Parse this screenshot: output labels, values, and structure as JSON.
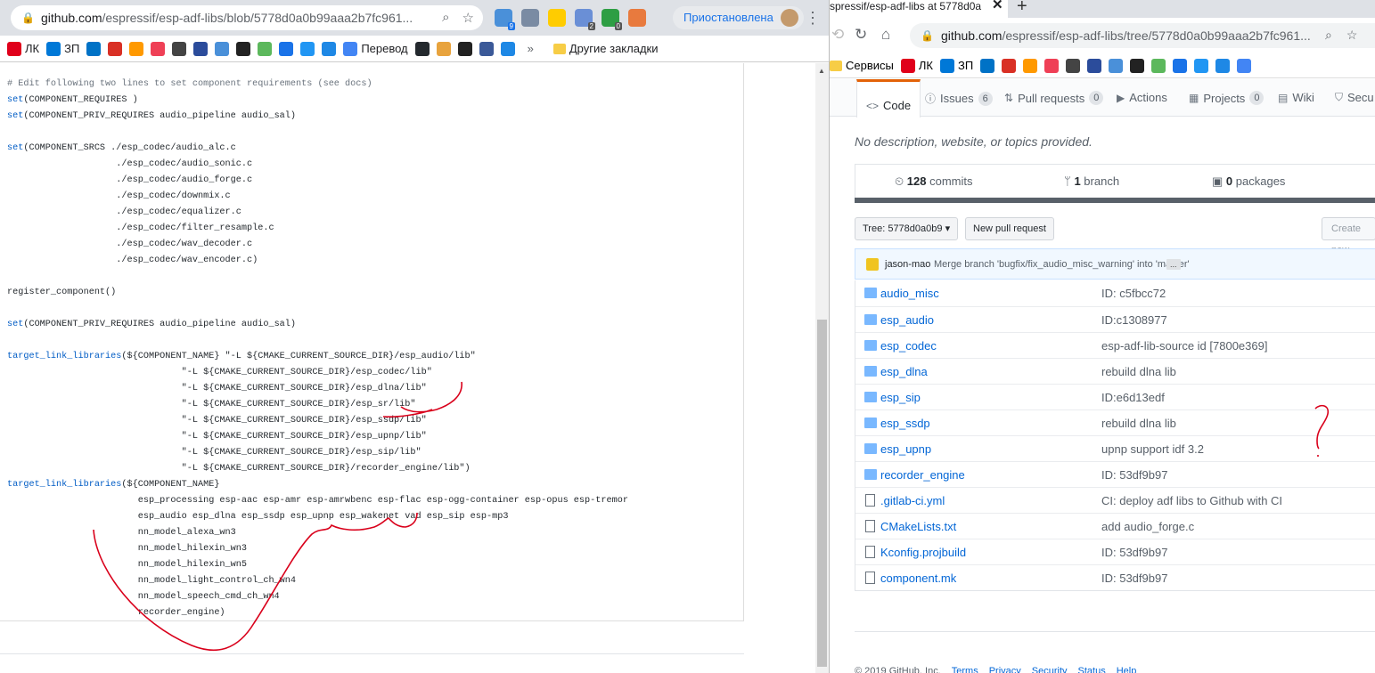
{
  "left_browser": {
    "url_host": "github.com",
    "url_path": "/espressif/esp-adf-libs/blob/5778d0a0b99aaa2b7fc961...",
    "profile_label": "Приостановлена",
    "extension_badges": {
      "badge_9": "9",
      "badge_2": "2",
      "badge_0": "0"
    },
    "bookmarks": [
      {
        "label": "ЛК",
        "icon": "opera-icon",
        "color": "#e0001b"
      },
      {
        "label": "ЗП",
        "icon": "skype-icon",
        "color": "#0078d7"
      },
      {
        "label": "",
        "icon": "outlook-icon",
        "color": "#0072c6"
      },
      {
        "label": "",
        "icon": "gmail-icon",
        "color": "#d93025"
      },
      {
        "label": "",
        "icon": "mail-icon",
        "color": "#ff9900"
      },
      {
        "label": "",
        "icon": "pocket-icon",
        "color": "#ef4056"
      },
      {
        "label": "",
        "icon": "bag-icon",
        "color": "#444444"
      },
      {
        "label": "",
        "icon": "emblem-icon",
        "color": "#2b4c9b"
      },
      {
        "label": "",
        "icon": "map-icon",
        "color": "#4a90d9"
      },
      {
        "label": "",
        "icon": "circle-icon",
        "color": "#222222"
      },
      {
        "label": "",
        "icon": "two-icon",
        "color": "#5cb85c"
      },
      {
        "label": "",
        "icon": "g-icon",
        "color": "#1a73e8"
      },
      {
        "label": "",
        "icon": "ring-icon",
        "color": "#2196f3"
      },
      {
        "label": "",
        "icon": "vs-icon",
        "color": "#1e88e5"
      },
      {
        "label": "Перевод",
        "icon": "translate-icon",
        "color": "#4285f4"
      },
      {
        "label": "",
        "icon": "github-icon",
        "color": "#24292e"
      },
      {
        "label": "",
        "icon": "fox-icon",
        "color": "#e8a33d"
      },
      {
        "label": "",
        "icon": "a-icon",
        "color": "#222222"
      },
      {
        "label": "",
        "icon": "facebook-icon",
        "color": "#3b5998"
      },
      {
        "label": "",
        "icon": "network-icon",
        "color": "#1e88e5"
      }
    ],
    "more_bookmarks": "»",
    "other_bookmarks": "Другие закладки",
    "code_lines": [
      {
        "t": "cm",
        "text": "# Edit following two lines to set component requirements (see docs)"
      },
      {
        "t": "mix",
        "kw": "set",
        "text": "(COMPONENT_REQUIRES )"
      },
      {
        "t": "mix",
        "kw": "set",
        "text": "(COMPONENT_PRIV_REQUIRES audio_pipeline audio_sal)"
      },
      {
        "t": "pl",
        "text": ""
      },
      {
        "t": "mix",
        "kw": "set",
        "text": "(COMPONENT_SRCS ./esp_codec/audio_alc.c"
      },
      {
        "t": "pl",
        "text": "                    ./esp_codec/audio_sonic.c"
      },
      {
        "t": "pl",
        "text": "                    ./esp_codec/audio_forge.c"
      },
      {
        "t": "pl",
        "text": "                    ./esp_codec/downmix.c"
      },
      {
        "t": "pl",
        "text": "                    ./esp_codec/equalizer.c"
      },
      {
        "t": "pl",
        "text": "                    ./esp_codec/filter_resample.c"
      },
      {
        "t": "pl",
        "text": "                    ./esp_codec/wav_decoder.c"
      },
      {
        "t": "pl",
        "text": "                    ./esp_codec/wav_encoder.c)"
      },
      {
        "t": "pl",
        "text": ""
      },
      {
        "t": "pl",
        "text": "register_component()"
      },
      {
        "t": "pl",
        "text": ""
      },
      {
        "t": "mix",
        "kw": "set",
        "text": "(COMPONENT_PRIV_REQUIRES audio_pipeline audio_sal)"
      },
      {
        "t": "pl",
        "text": ""
      },
      {
        "t": "mix",
        "kw": "target_link_libraries",
        "text": "(${COMPONENT_NAME} \"-L ${CMAKE_CURRENT_SOURCE_DIR}/esp_audio/lib\""
      },
      {
        "t": "pl",
        "text": "                                \"-L ${CMAKE_CURRENT_SOURCE_DIR}/esp_codec/lib\""
      },
      {
        "t": "pl",
        "text": "                                \"-L ${CMAKE_CURRENT_SOURCE_DIR}/esp_dlna/lib\""
      },
      {
        "t": "pl",
        "text": "                                \"-L ${CMAKE_CURRENT_SOURCE_DIR}/esp_sr/lib\""
      },
      {
        "t": "pl",
        "text": "                                \"-L ${CMAKE_CURRENT_SOURCE_DIR}/esp_ssdp/lib\""
      },
      {
        "t": "pl",
        "text": "                                \"-L ${CMAKE_CURRENT_SOURCE_DIR}/esp_upnp/lib\""
      },
      {
        "t": "pl",
        "text": "                                \"-L ${CMAKE_CURRENT_SOURCE_DIR}/esp_sip/lib\""
      },
      {
        "t": "pl",
        "text": "                                \"-L ${CMAKE_CURRENT_SOURCE_DIR}/recorder_engine/lib\")"
      },
      {
        "t": "mix",
        "kw": "target_link_libraries",
        "text": "(${COMPONENT_NAME}"
      },
      {
        "t": "pl",
        "text": "                        esp_processing esp-aac esp-amr esp-amrwbenc esp-flac esp-ogg-container esp-opus esp-tremor"
      },
      {
        "t": "pl",
        "text": "                        esp_audio esp_dlna esp_ssdp esp_upnp esp_wakenet vad esp_sip esp-mp3"
      },
      {
        "t": "pl",
        "text": "                        nn_model_alexa_wn3"
      },
      {
        "t": "pl",
        "text": "                        nn_model_hilexin_wn3"
      },
      {
        "t": "pl",
        "text": "                        nn_model_hilexin_wn5"
      },
      {
        "t": "pl",
        "text": "                        nn_model_light_control_ch_wn4"
      },
      {
        "t": "pl",
        "text": "                        nn_model_speech_cmd_ch_wn4"
      },
      {
        "t": "pl",
        "text": "                        recorder_engine)"
      }
    ]
  },
  "right_browser": {
    "tab_title": "spressif/esp-adf-libs at 5778d0a",
    "url_host": "github.com",
    "url_path": "/espressif/esp-adf-libs/tree/5778d0a0b99aaa2b7fc961...",
    "bookmarks_first_label": "Сервисы",
    "bookmark_labels": [
      "ЛК",
      "ЗП"
    ],
    "repo_tabs": [
      {
        "label": "Code",
        "count": ""
      },
      {
        "label": "Issues",
        "count": "6"
      },
      {
        "label": "Pull requests",
        "count": "0"
      },
      {
        "label": "Actions",
        "count": ""
      },
      {
        "label": "Projects",
        "count": "0"
      },
      {
        "label": "Wiki",
        "count": ""
      },
      {
        "label": "Secu",
        "count": ""
      }
    ],
    "description": "No description, website, or topics provided.",
    "summary": {
      "commits_num": "128",
      "commits_label": "commits",
      "branch_num": "1",
      "branch_label": "branch",
      "packages_num": "0",
      "packages_label": "packages"
    },
    "tree_button": "Tree: 5778d0a0b9",
    "new_pr_button": "New pull request",
    "create_button": "Create new",
    "latest_commit": {
      "author": "jason-mao",
      "message": "Merge branch 'bugfix/fix_audio_misc_warning' into 'master'",
      "ellipsis": "..."
    },
    "files": [
      {
        "name": "audio_misc",
        "type": "dir",
        "message": "ID: c5fbcc72"
      },
      {
        "name": "esp_audio",
        "type": "dir",
        "message": "ID:c1308977"
      },
      {
        "name": "esp_codec",
        "type": "dir",
        "message": "esp-adf-lib-source id [7800e369]"
      },
      {
        "name": "esp_dlna",
        "type": "dir",
        "message": "rebuild dlna lib"
      },
      {
        "name": "esp_sip",
        "type": "dir",
        "message": "ID:e6d13edf"
      },
      {
        "name": "esp_ssdp",
        "type": "dir",
        "message": "rebuild dlna lib"
      },
      {
        "name": "esp_upnp",
        "type": "dir",
        "message": "upnp support idf 3.2"
      },
      {
        "name": "recorder_engine",
        "type": "dir",
        "message": "ID: 53df9b97"
      },
      {
        "name": ".gitlab-ci.yml",
        "type": "file",
        "message": "CI: deploy adf libs to Github with CI"
      },
      {
        "name": "CMakeLists.txt",
        "type": "file",
        "message": "add audio_forge.c"
      },
      {
        "name": "Kconfig.projbuild",
        "type": "file",
        "message": "ID: 53df9b97"
      },
      {
        "name": "component.mk",
        "type": "file",
        "message": "ID: 53df9b97"
      }
    ],
    "footer": {
      "copyright": "© 2019 GitHub, Inc.",
      "links": [
        "Terms",
        "Privacy",
        "Security",
        "Status",
        "Help"
      ]
    }
  },
  "colors": {
    "annotation_red": "#d9001b",
    "github_link": "#0366d6",
    "tab_active_accent": "#e36209"
  }
}
